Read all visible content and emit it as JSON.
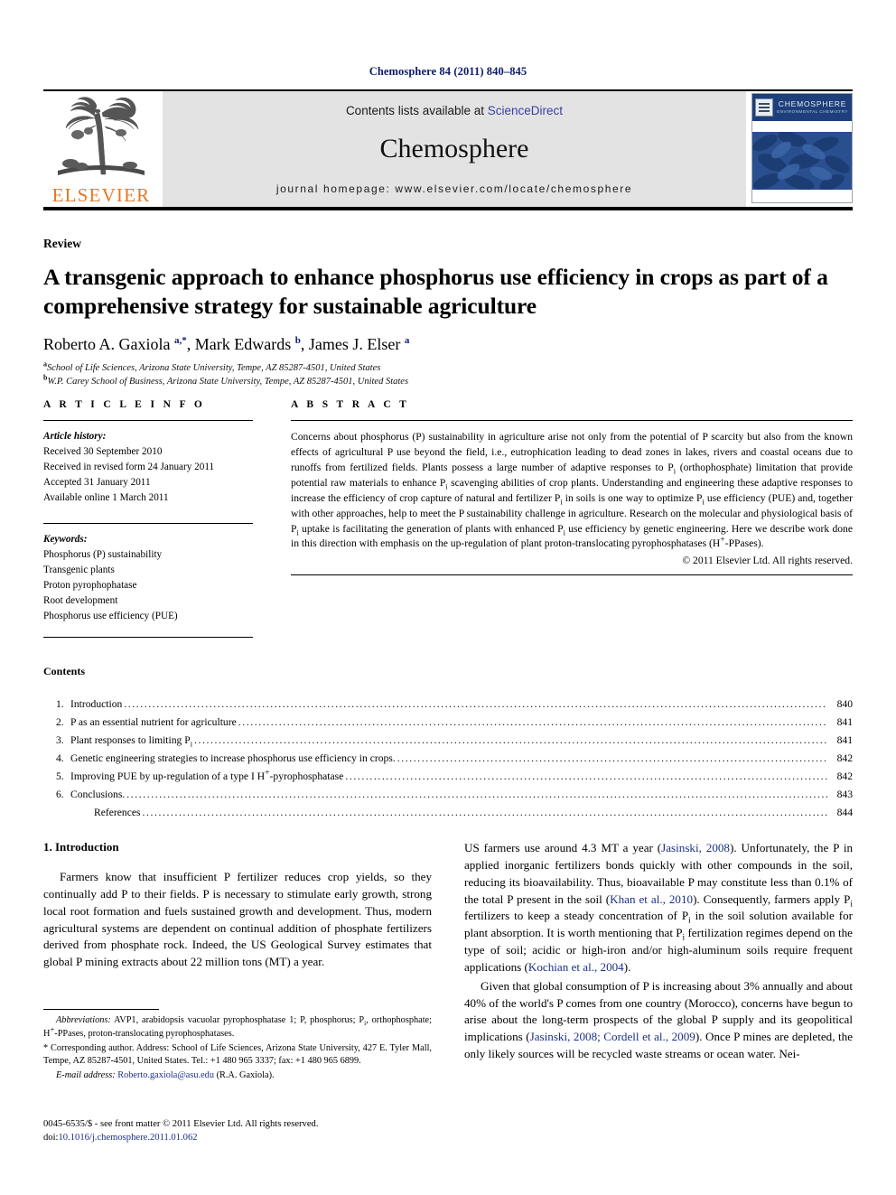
{
  "running_head": "Chemosphere 84 (2011) 840–845",
  "masthead": {
    "contents_lists_prefix": "Contents lists available at ",
    "sciencedirect": "ScienceDirect",
    "journal_name": "Chemosphere",
    "homepage": "journal homepage: www.elsevier.com/locate/chemosphere",
    "publisher_wordmark": "ELSEVIER",
    "cover": {
      "title": "CHEMOSPHERE",
      "subtitle": "ENVIRONMENTAL CHEMISTRY"
    },
    "colors": {
      "elsevier_orange": "#e87722",
      "link_blue": "#3a3fa8",
      "banner_grey": "#e3e3e3",
      "cover_blue": "#1d3f7a"
    }
  },
  "article": {
    "type": "Review",
    "title": "A transgenic approach to enhance phosphorus use efficiency in crops as part of a comprehensive strategy for sustainable agriculture",
    "authors_html": "Roberto A. Gaxiola <sup>a,*</sup>, Mark Edwards <sup>b</sup>, James J. Elser <sup>a</sup>",
    "affiliations": [
      {
        "marker": "a",
        "text": "School of Life Sciences, Arizona State University, Tempe, AZ 85287-4501, United States"
      },
      {
        "marker": "b",
        "text": "W.P. Carey School of Business, Arizona State University, Tempe, AZ 85287-4501, United States"
      }
    ]
  },
  "article_info": {
    "heading": "A R T I C L E   I N F O",
    "history_label": "Article history:",
    "history": [
      "Received 30 September 2010",
      "Received in revised form 24 January 2011",
      "Accepted 31 January 2011",
      "Available online 1 March 2011"
    ],
    "keywords_label": "Keywords:",
    "keywords": [
      "Phosphorus (P) sustainability",
      "Transgenic plants",
      "Proton pyrophophatase",
      "Root development",
      "Phosphorus use efficiency (PUE)"
    ]
  },
  "abstract": {
    "heading": "A B S T R A C T",
    "text_html": "Concerns about phosphorus (P) sustainability in agriculture arise not only from the potential of P scarcity but also from the known effects of agricultural P use beyond the field, i.e., eutrophication leading to dead zones in lakes, rivers and coastal oceans due to runoffs from fertilized fields. Plants possess a large number of adaptive responses to P<sub>i</sub> (orthophosphate) limitation that provide potential raw materials to enhance P<sub>i</sub> scavenging abilities of crop plants. Understanding and engineering these adaptive responses to increase the efficiency of crop capture of natural and fertilizer P<sub>i</sub> in soils is one way to optimize P<sub>i</sub> use efficiency (PUE) and, together with other approaches, help to meet the P sustainability challenge in agriculture. Research on the molecular and physiological basis of P<sub>i</sub> uptake is facilitating the generation of plants with enhanced P<sub>i</sub> use efficiency by genetic engineering. Here we describe work done in this direction with emphasis on the up-regulation of plant proton-translocating pyrophosphatases (H<sup>+</sup>-PPases).",
    "copyright": "© 2011 Elsevier Ltd. All rights reserved."
  },
  "contents": {
    "heading": "Contents",
    "entries": [
      {
        "num": "1.",
        "label_html": "Introduction",
        "page": "840"
      },
      {
        "num": "2.",
        "label_html": "P as an essential nutrient for agriculture",
        "page": "841"
      },
      {
        "num": "3.",
        "label_html": "Plant responses to limiting P<sub>i</sub>",
        "page": "841"
      },
      {
        "num": "4.",
        "label_html": "Genetic engineering strategies to increase phosphorus use efficiency in crops.",
        "page": "842"
      },
      {
        "num": "5.",
        "label_html": "Improving PUE by up-regulation of a type I H<sup>+</sup>-pyrophosphatase",
        "page": "842"
      },
      {
        "num": "6.",
        "label_html": "Conclusions.",
        "page": "843"
      },
      {
        "num": "",
        "label_html": "References",
        "page": "844"
      }
    ]
  },
  "body": {
    "section_title": "1. Introduction",
    "left_paragraphs_html": [
      "Farmers know that insufficient P fertilizer reduces crop yields, so they continually add P to their fields. P is necessary to stimulate early growth, strong local root formation and fuels sustained growth and development. Thus, modern agricultural systems are dependent on continual addition of phosphate fertilizers derived from phosphate rock. Indeed, the US Geological Survey estimates that global P mining extracts about 22 million tons (MT) a year."
    ],
    "right_paragraphs_html": [
      "US farmers use around 4.3 MT a year (<span class=\"cite\">Jasinski, 2008</span>). Unfortunately, the P in applied inorganic fertilizers bonds quickly with other compounds in the soil, reducing its bioavailability. Thus, bioavailable P may constitute less than 0.1% of the total P present in the soil (<span class=\"cite\">Khan et al., 2010</span>). Consequently, farmers apply P<sub>i</sub> fertilizers to keep a steady concentration of P<sub>i</sub> in the soil solution available for plant absorption. It is worth mentioning that P<sub>i</sub> fertilization regimes depend on the type of soil; acidic or high-iron and/or high-aluminum soils require frequent applications (<span class=\"cite\">Kochian et al., 2004</span>).",
      "Given that global consumption of P is increasing about 3% annually and about 40% of the world's P comes from one country (Morocco), concerns have begun to arise about the long-term prospects of the global P supply and its geopolitical implications (<span class=\"cite\">Jasinski, 2008; Cordell et al., 2009</span>). Once P mines are depleted, the only likely sources will be recycled waste streams or ocean water. Nei-"
    ]
  },
  "footnotes": {
    "abbreviations_html": "<span class=\"it\">Abbreviations:</span> AVP1, arabidopsis vacuolar pyrophosphatase 1; P, phosphorus; P<sub>i</sub>, orthophosphate; H<sup>+</sup>-PPases, proton-translocating pyrophosphatases.",
    "corresponding_html": "* Corresponding author. Address: School of Life Sciences, Arizona State University, 427 E. Tyler Mall, Tempe, AZ 85287-4501, United States. Tel.: +1 480 965 3337; fax: +1 480 965 6899.",
    "email_label": "E-mail address:",
    "email": "Roberto.gaxiola@asu.edu",
    "email_suffix": "(R.A. Gaxiola)."
  },
  "imprint": {
    "line1": "0045-6535/$ - see front matter © 2011 Elsevier Ltd. All rights reserved.",
    "doi_label": "doi:",
    "doi": "10.1016/j.chemosphere.2011.01.062"
  }
}
